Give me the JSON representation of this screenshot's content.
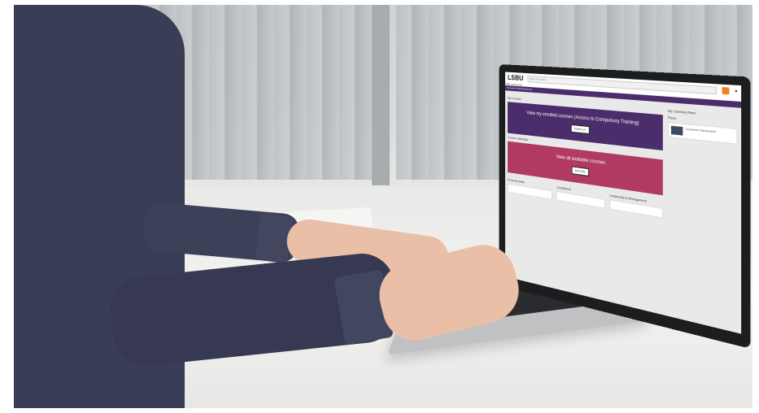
{
  "screen": {
    "logo": "LSBU",
    "search_placeholder": "Search for courses",
    "breadcrumb": "LSBU Learning Hub",
    "nav_label": "Personal & Staff Development",
    "section_my_courses": "My Courses",
    "enrolled_card": {
      "title": "View my enrolled courses (Access to Compulsory Training)",
      "button": "ENROL UP"
    },
    "section_catalogue": "Course Catalogue",
    "available_card": {
      "title": "View all available courses",
      "button": "EXPLORE"
    },
    "row_headings": [
      "Personal Skills",
      "Compliance",
      "Leadership & Management"
    ],
    "side_heading": "My Learning Plans",
    "side_sub": "Plans",
    "plan_item": "Compulsory Training 2024"
  },
  "colors": {
    "brand_purple": "#4b2d6b",
    "brand_pink": "#b03a62",
    "accent_orange": "#f07f22"
  }
}
